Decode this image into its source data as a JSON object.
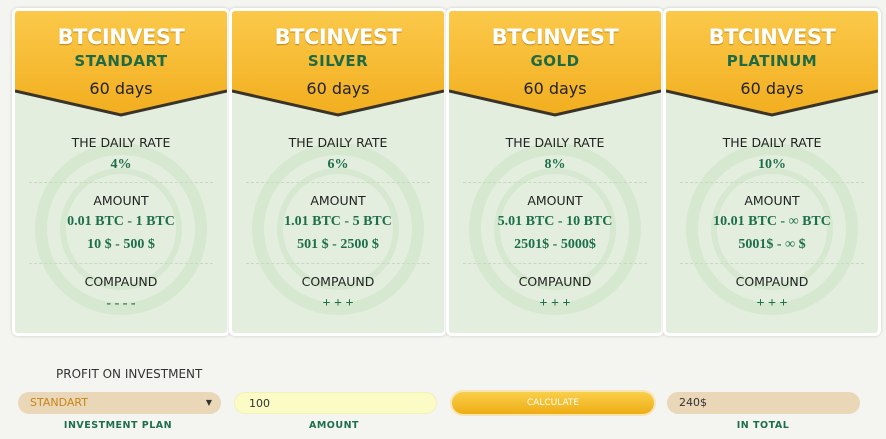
{
  "plans": [
    {
      "brand": "BTCINVEST",
      "name": "STANDART",
      "days": "60 days",
      "rate_label": "THE DAILY RATE",
      "rate": "4%",
      "amount_label": "AMOUNT",
      "amount_btc": "0.01 BTC  -  1 BTC",
      "amount_usd": "10 $  -  500 $",
      "compound_label": "COMPAUND",
      "compound": "- - - -"
    },
    {
      "brand": "BTCINVEST",
      "name": "SILVER",
      "days": "60 days",
      "rate_label": "THE DAILY RATE",
      "rate": "6%",
      "amount_label": "AMOUNT",
      "amount_btc": "1.01 BTC  -  5 BTC",
      "amount_usd": "501 $  -  2500 $",
      "compound_label": "COMPAUND",
      "compound": "+ + +"
    },
    {
      "brand": "BTCINVEST",
      "name": "GOLD",
      "days": "60 days",
      "rate_label": "THE DAILY RATE",
      "rate": "8%",
      "amount_label": "AMOUNT",
      "amount_btc": "5.01 BTC  -  10 BTC",
      "amount_usd": "2501$  -  5000$",
      "compound_label": "COMPAUND",
      "compound": "+ + +"
    },
    {
      "brand": "BTCINVEST",
      "name": "PLATINUM",
      "days": "60 days",
      "rate_label": "THE DAILY RATE",
      "rate": "10%",
      "amount_label": "AMOUNT",
      "amount_btc": "10.01 BTC  -  ∞ BTC",
      "amount_usd": "5001$  -  ∞ $",
      "compound_label": "COMPAUND",
      "compound": "+ + +"
    }
  ],
  "calculator": {
    "title": "PROFIT ON INVESTMENT",
    "plan_value": "STANDART",
    "plan_caption": "INVESTMENT PLAN",
    "amount_value": "100",
    "amount_caption": "AMOUNT",
    "calculate_label": "CALCULATE",
    "total_value": "240$",
    "total_caption": "IN TOTAL"
  },
  "colors": {
    "header_gold": "#f7bd2b",
    "plan_green": "#1f6a44",
    "card_bg": "#e3eedf"
  }
}
